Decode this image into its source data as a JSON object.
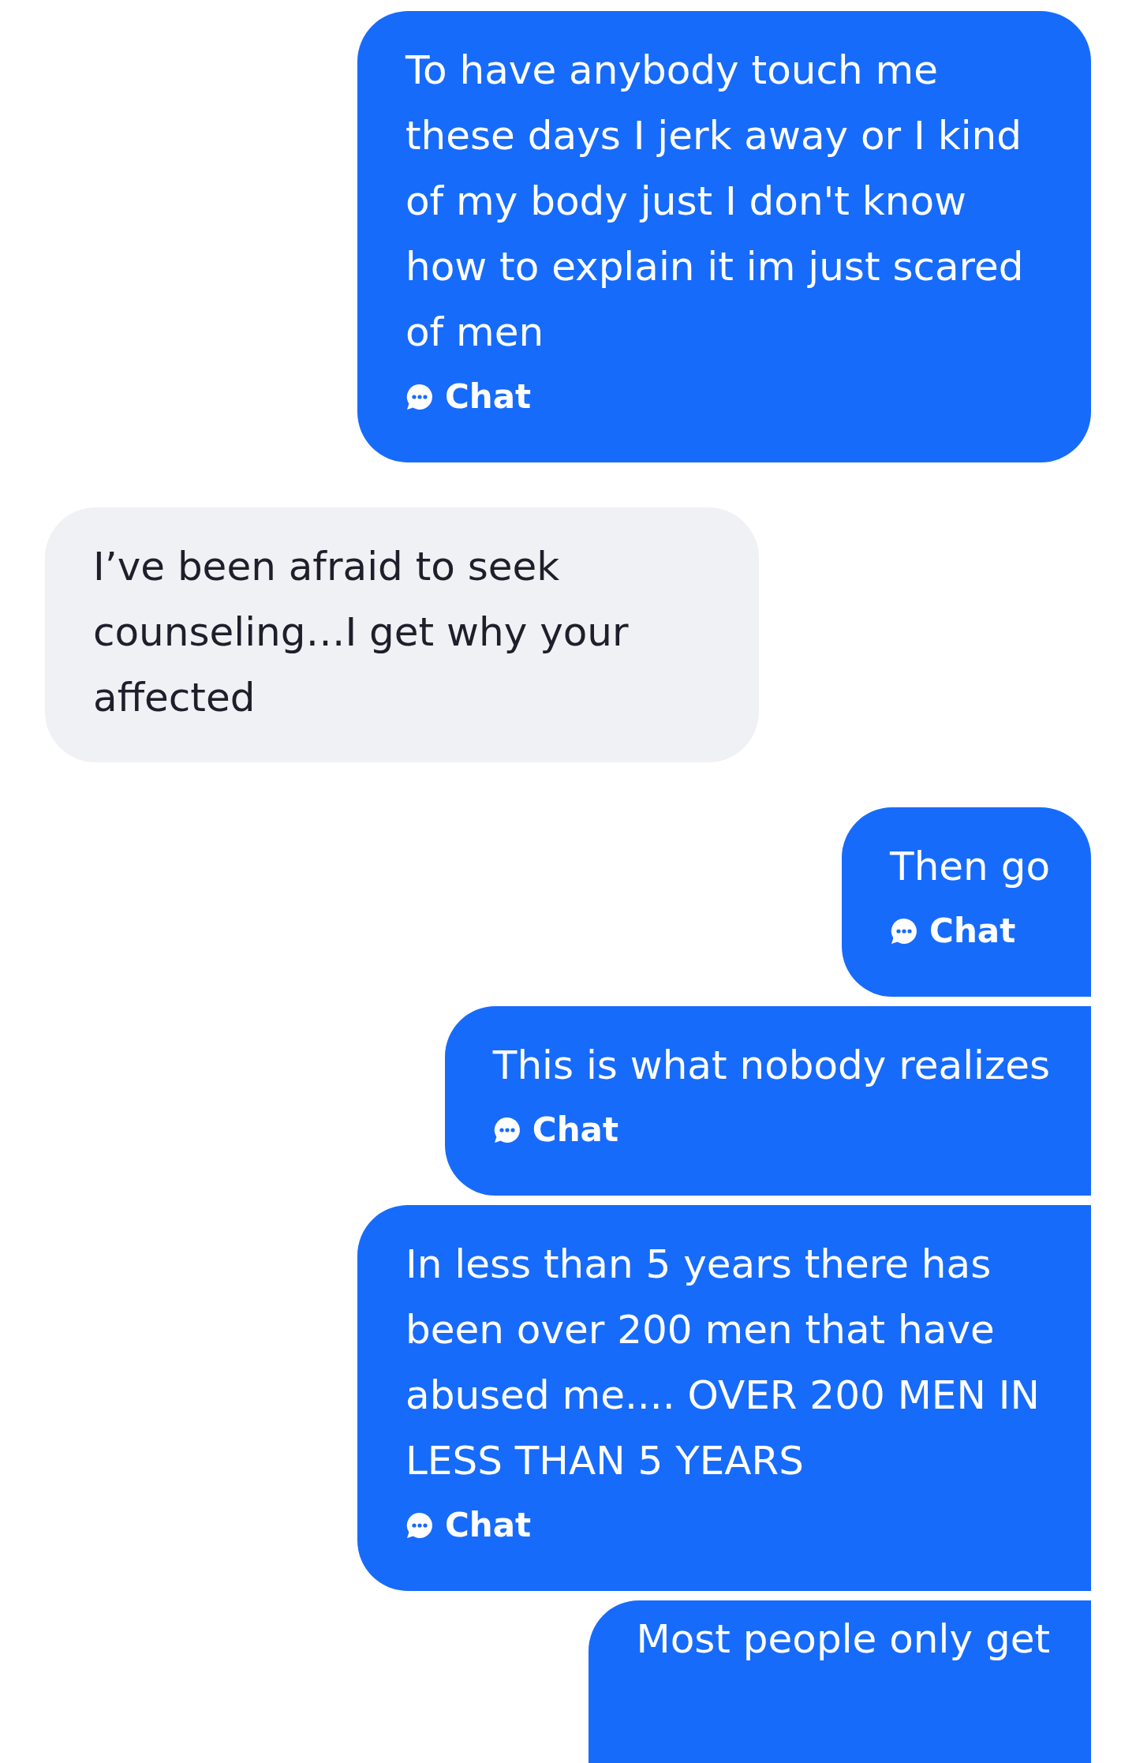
{
  "messages": [
    {
      "kind": "sent",
      "text": "To have anybody touch me these days I jerk away or I kind of my body just I don't know how to explain it im just scared of men",
      "label": "Chat",
      "grouped_with_previous": false,
      "grouped_with_next": false
    },
    {
      "kind": "received",
      "text": "I’ve been afraid to seek counseling…I get why your affected",
      "grouped_with_previous": false,
      "grouped_with_next": false
    },
    {
      "kind": "sent",
      "text": "Then go",
      "label": "Chat",
      "grouped_with_previous": false,
      "grouped_with_next": true
    },
    {
      "kind": "sent",
      "text": "This is what nobody realizes",
      "label": "Chat",
      "grouped_with_previous": true,
      "grouped_with_next": true
    },
    {
      "kind": "sent",
      "text": "In less than 5 years there has been over 200 men that have abused me.... OVER 200 MEN IN LESS THAN 5 YEARS",
      "label": "Chat",
      "grouped_with_previous": true,
      "grouped_with_next": true
    },
    {
      "kind": "sent",
      "text": "Most people only get",
      "grouped_with_previous": true,
      "grouped_with_next": false,
      "cut": true
    }
  ]
}
